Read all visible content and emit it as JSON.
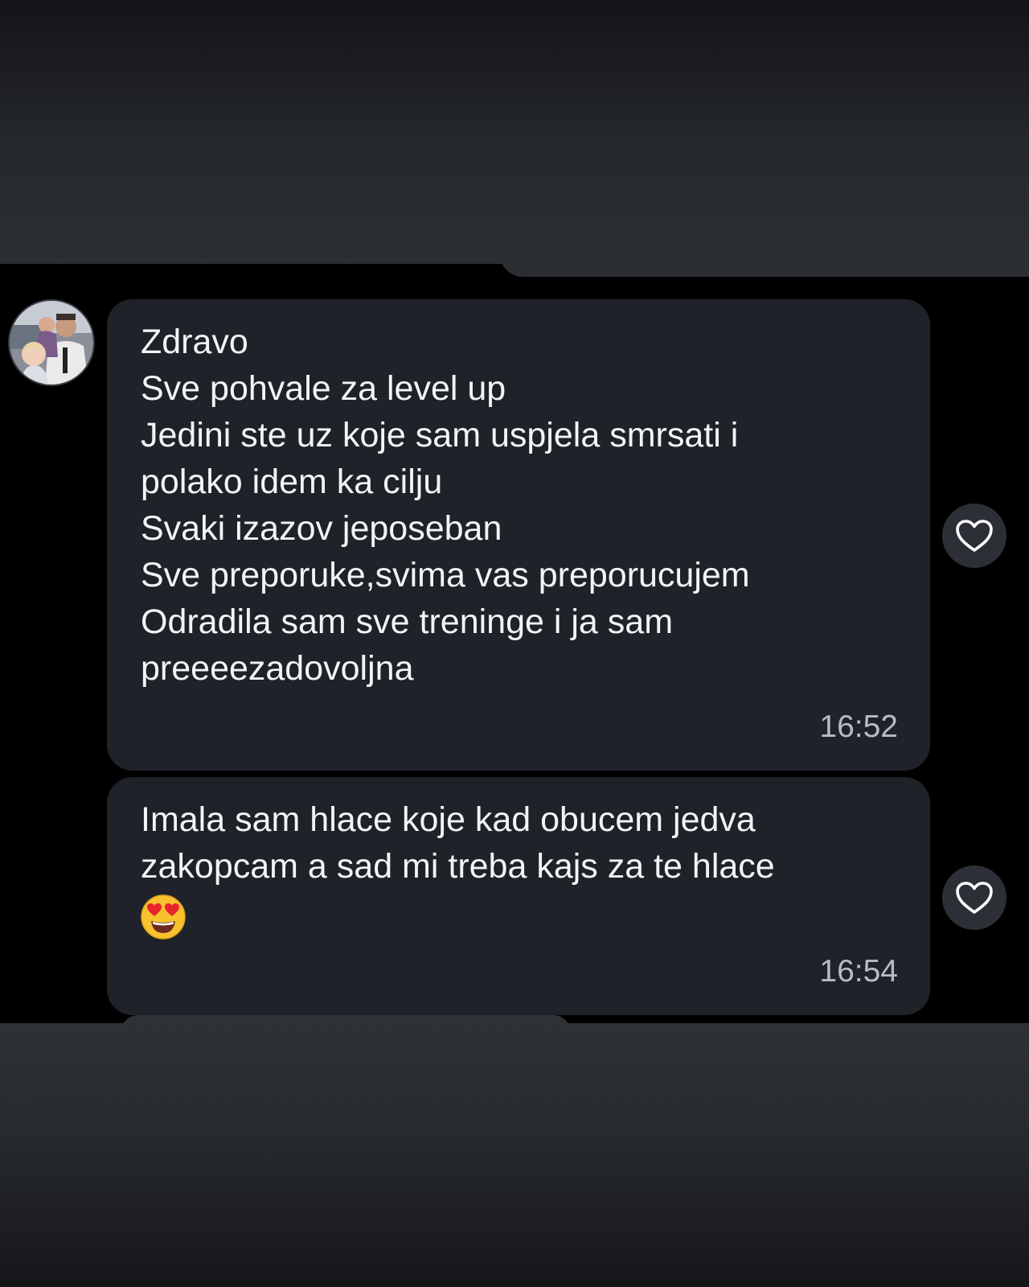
{
  "messages": [
    {
      "lines": [
        "Zdravo",
        "Sve pohvale za level up",
        "Jedini ste uz koje sam uspjela smrsati i",
        "polako idem ka cilju",
        "Svaki izazov jeposeban",
        "Sve preporuke,svima vas preporucujem",
        "Odradila sam sve treninge i ja sam",
        "preeeezadovoljna"
      ],
      "time": "16:52"
    },
    {
      "lines": [
        "Imala sam hlace koje kad obucem jedva",
        "zakopcam a sad mi treba kajs za te hlace"
      ],
      "emoji": "heart-eyes-emoji",
      "time": "16:54"
    }
  ],
  "icons": {
    "like": "heart-outline-icon",
    "emoji": "heart-eyes-emoji"
  },
  "colors": {
    "background": "#000000",
    "bubble": "#1f2228",
    "text": "#f3f4f6",
    "time": "#b8bcc2",
    "like_button": "#2c2f35"
  }
}
